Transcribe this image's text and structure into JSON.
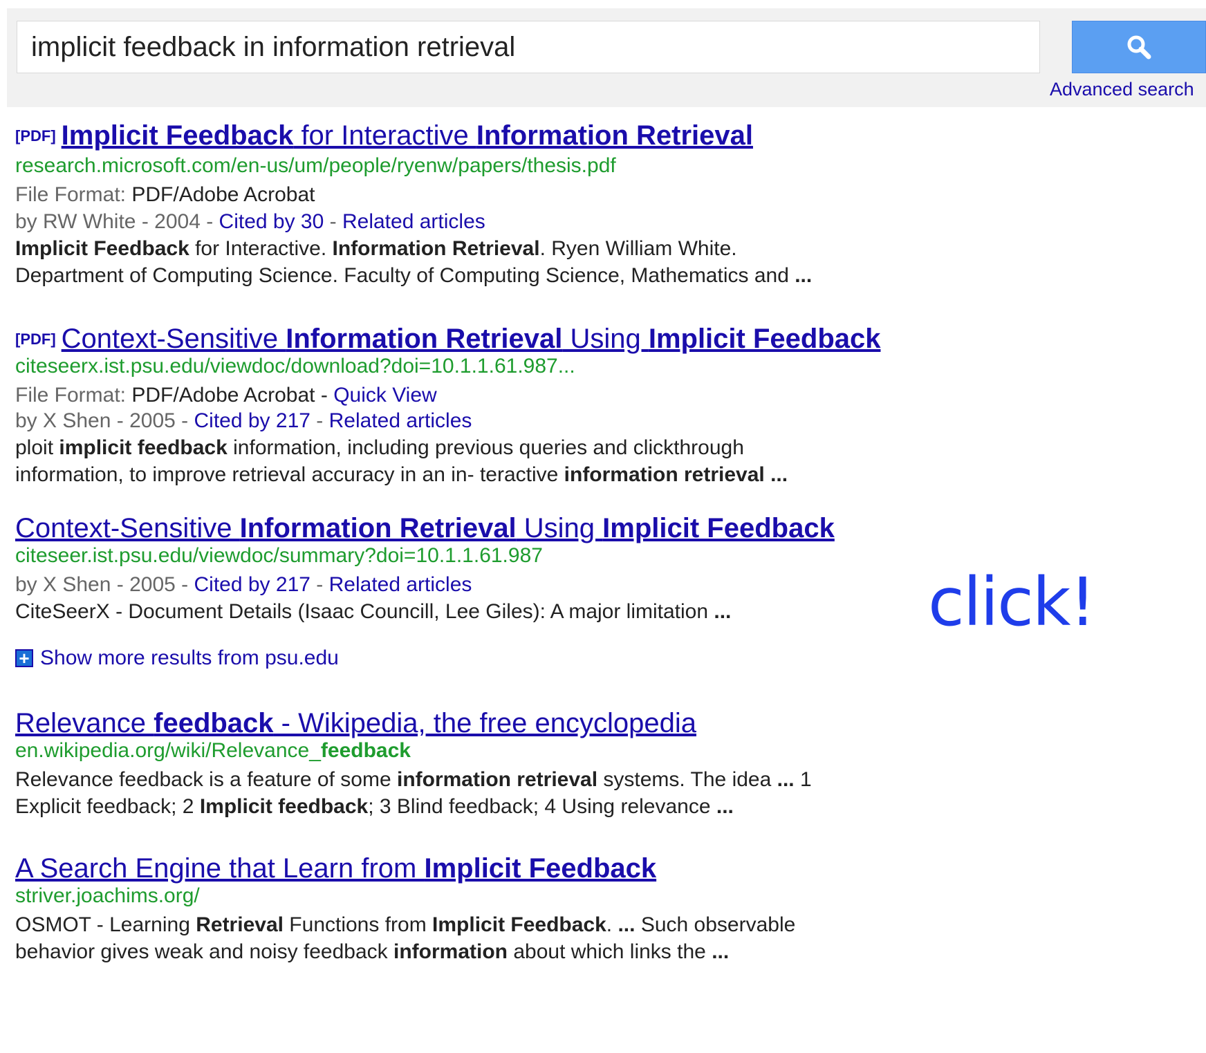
{
  "search": {
    "query": "implicit feedback in information retrieval",
    "advanced_label": "Advanced search",
    "button_icon": "search-icon"
  },
  "results": [
    {
      "pdf_tag": "[PDF]",
      "title_parts": [
        {
          "text": "Implicit Feedback",
          "bold": true
        },
        {
          "text": " for Interactive ",
          "bold": false
        },
        {
          "text": "Information Retrieval",
          "bold": true
        }
      ],
      "url": "research.microsoft.com/en-us/um/people/ryenw/papers/thesis.pdf",
      "file_format_label": "File Format: ",
      "file_format_value": "PDF/Adobe Acrobat",
      "by_line": "by RW White - 2004 - ",
      "cited": "Cited by 30",
      "related": "Related articles",
      "snippet_lines": [
        [
          {
            "text": "Implicit Feedback",
            "bold": true
          },
          {
            "text": " for Interactive. ",
            "bold": false
          },
          {
            "text": "Information Retrieval",
            "bold": true
          },
          {
            "text": ". Ryen William White.",
            "bold": false
          }
        ],
        [
          {
            "text": "Department of Computing Science. Faculty of Computing Science, Mathematics and ",
            "bold": false
          },
          {
            "text": "...",
            "bold": true
          }
        ]
      ]
    },
    {
      "pdf_tag": "[PDF]",
      "title_parts": [
        {
          "text": "Context-Sensitive ",
          "bold": false
        },
        {
          "text": "Information Retrieval",
          "bold": true
        },
        {
          "text": " Using ",
          "bold": false
        },
        {
          "text": "Implicit Feedback",
          "bold": true
        }
      ],
      "url": "citeseerx.ist.psu.edu/viewdoc/download?doi=10.1.1.61.987...",
      "file_format_label": "File Format: ",
      "file_format_value": "PDF/Adobe Acrobat",
      "quick_view": "Quick View",
      "by_line": "by X Shen - 2005 - ",
      "cited": "Cited by 217",
      "related": "Related articles",
      "snippet_lines": [
        [
          {
            "text": "ploit ",
            "bold": false
          },
          {
            "text": "implicit feedback",
            "bold": true
          },
          {
            "text": " information, including previous queries and clickthrough",
            "bold": false
          }
        ],
        [
          {
            "text": "information, to improve retrieval accuracy in an in- teractive ",
            "bold": false
          },
          {
            "text": "information retrieval",
            "bold": true
          },
          {
            "text": " ...",
            "bold": true
          }
        ]
      ]
    },
    {
      "title_parts": [
        {
          "text": "Context-Sensitive ",
          "bold": false
        },
        {
          "text": "Information Retrieval",
          "bold": true
        },
        {
          "text": " Using ",
          "bold": false
        },
        {
          "text": "Implicit Feedback",
          "bold": true
        }
      ],
      "url": "citeseer.ist.psu.edu/viewdoc/summary?doi=10.1.1.61.987",
      "by_line": "by X Shen - 2005 - ",
      "cited": "Cited by 217",
      "related": "Related articles",
      "snippet_lines": [
        [
          {
            "text": "CiteSeerX - Document Details (Isaac Councill, Lee Giles): A major limitation ",
            "bold": false
          },
          {
            "text": "...",
            "bold": true
          }
        ]
      ],
      "more_results": "Show more results from psu.edu"
    },
    {
      "title_parts": [
        {
          "text": "Relevance ",
          "bold": false
        },
        {
          "text": "feedback",
          "bold": true
        },
        {
          "text": " - Wikipedia, the free encyclopedia",
          "bold": false
        }
      ],
      "url_parts": [
        {
          "text": "en.wikipedia.org/wiki/Relevance_",
          "bold": false
        },
        {
          "text": "feedback",
          "bold": true
        }
      ],
      "snippet_lines": [
        [
          {
            "text": "Relevance feedback is a feature of some ",
            "bold": false
          },
          {
            "text": "information retrieval",
            "bold": true
          },
          {
            "text": " systems. The idea ",
            "bold": false
          },
          {
            "text": "...",
            "bold": true
          },
          {
            "text": " 1",
            "bold": false
          }
        ],
        [
          {
            "text": "Explicit feedback; 2 ",
            "bold": false
          },
          {
            "text": "Implicit feedback",
            "bold": true
          },
          {
            "text": "; 3 Blind feedback; 4 Using relevance ",
            "bold": false
          },
          {
            "text": "...",
            "bold": true
          }
        ]
      ]
    },
    {
      "title_parts": [
        {
          "text": "A Search Engine that Learn from ",
          "bold": false
        },
        {
          "text": "Implicit Feedback",
          "bold": true
        }
      ],
      "url": "striver.joachims.org/",
      "snippet_lines": [
        [
          {
            "text": "OSMOT - Learning ",
            "bold": false
          },
          {
            "text": "Retrieval",
            "bold": true
          },
          {
            "text": " Functions from ",
            "bold": false
          },
          {
            "text": "Implicit Feedback",
            "bold": true
          },
          {
            "text": ". ",
            "bold": false
          },
          {
            "text": "...",
            "bold": true
          },
          {
            "text": " Such observable",
            "bold": false
          }
        ],
        [
          {
            "text": "behavior gives weak and noisy feedback ",
            "bold": false
          },
          {
            "text": "information",
            "bold": true
          },
          {
            "text": " about which links the ",
            "bold": false
          },
          {
            "text": "...",
            "bold": true
          }
        ]
      ]
    }
  ],
  "annotation": "click!",
  "colors": {
    "link": "#1a0dab",
    "url": "#1e9c2e",
    "meta": "#666666",
    "annotation": "#1f3dea",
    "search_button": "#5b9ff2"
  }
}
